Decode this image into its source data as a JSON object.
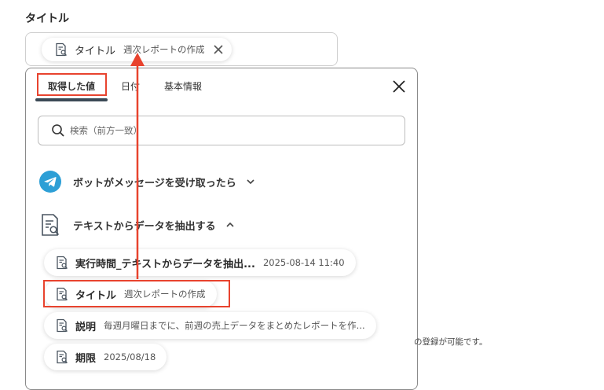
{
  "field": {
    "label": "タイトル"
  },
  "selected_chip": {
    "name": "タイトル",
    "value": "週次レポートの作成"
  },
  "dropdown": {
    "tabs": [
      {
        "label": "取得した値"
      },
      {
        "label": "日付"
      },
      {
        "label": "基本情報"
      }
    ],
    "search_placeholder": "検索（前方一致）",
    "sections": [
      {
        "label": "ボットがメッセージを受け取ったら",
        "expanded": false
      },
      {
        "label": "テキストからデータを抽出する",
        "expanded": true
      }
    ],
    "items": [
      {
        "name": "実行時間_テキストからデータを抽出...",
        "value": "2025-08-14 11:40"
      },
      {
        "name": "タイトル",
        "value": "週次レポートの作成"
      },
      {
        "name": "説明",
        "value": "毎週月曜日までに、前週の売上データをまとめたレポートを作..."
      },
      {
        "name": "期限",
        "value": "2025/08/18"
      }
    ]
  },
  "background_hint": "の登録が可能です。",
  "colors": {
    "highlight": "#e8432e",
    "telegram": "#2d9fd6",
    "tab_underline": "#3c4a56"
  },
  "icons": {
    "doc": "document-search-icon",
    "close": "close-icon",
    "search": "search-icon",
    "telegram": "telegram-icon"
  }
}
